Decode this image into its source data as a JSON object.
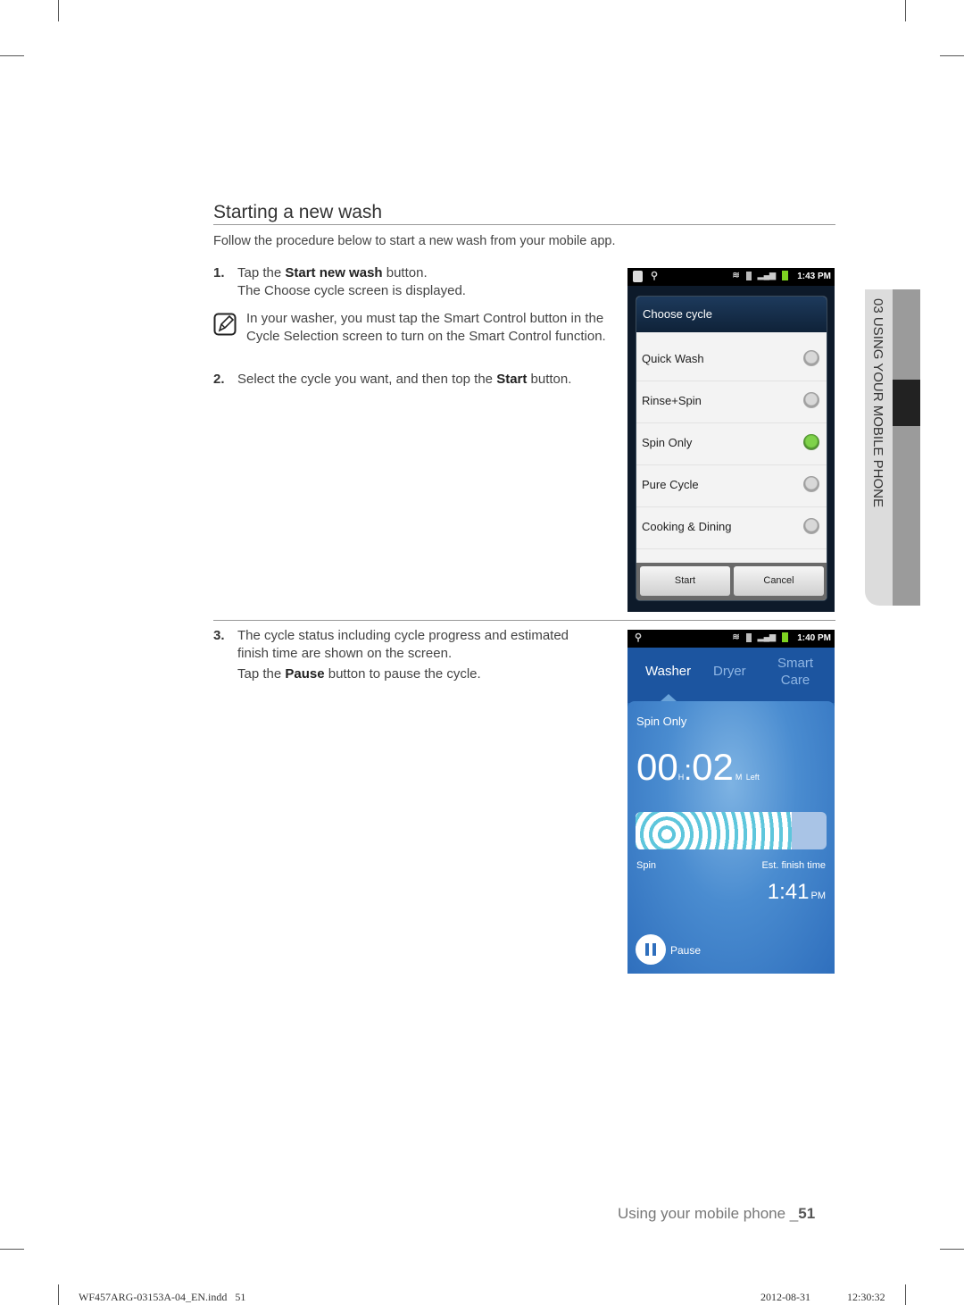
{
  "section": {
    "title": "Starting a new wash",
    "intro": "Follow the procedure below to start a new wash from your mobile app."
  },
  "steps": [
    {
      "number": "1.",
      "pre": "Tap the ",
      "bold": "Start new wash",
      "post": " button.",
      "sub": "The Choose cycle screen is displayed."
    },
    {
      "number": "2.",
      "pre": "Select the cycle you want, and then top the ",
      "bold": "Start",
      "post": " button."
    },
    {
      "number": "3.",
      "line1": "The cycle status including cycle progress and estimated",
      "line2": "finish time are shown on the screen.",
      "pre": "Tap the ",
      "bold": "Pause",
      "post": " button to pause the cycle."
    }
  ],
  "note": {
    "icon": "note-pencil-icon",
    "text": "In your washer, you must tap the Smart Control button in the Cycle Selection screen to turn on the Smart Control function."
  },
  "phone1": {
    "status_time": "1:43 PM",
    "dialog_title": "Choose cycle",
    "cycles": [
      {
        "label": "Quick Wash",
        "selected": false
      },
      {
        "label": "Rinse+Spin",
        "selected": false
      },
      {
        "label": "Spin Only",
        "selected": true
      },
      {
        "label": "Pure Cycle",
        "selected": false
      },
      {
        "label": "Cooking & Dining",
        "selected": false
      }
    ],
    "start_label": "Start",
    "cancel_label": "Cancel"
  },
  "phone2": {
    "status_time": "1:40 PM",
    "tabs": [
      "Washer",
      "Dryer",
      "Smart Care"
    ],
    "active_tab": "Washer",
    "cycle_name": "Spin Only",
    "hours": "00",
    "hours_unit": "H",
    "minutes": "02",
    "minutes_unit": "M",
    "left_label": "Left",
    "progress_fraction": 0.82,
    "phase_label": "Spin",
    "est_label": "Est. finish time",
    "finish_time": "1:41",
    "finish_ampm": "PM",
    "pause_label": "Pause",
    "colors": {
      "tab_active": "#ffffff",
      "tab_inactive": "#8fb6e4",
      "progress": "#5ec6dc"
    }
  },
  "side_tab": {
    "text": "03 USING YOUR MOBILE PHONE"
  },
  "footer": {
    "page_label": "Using your mobile phone _",
    "page_number": "51",
    "file": "WF457ARG-03153A-04_EN.indd   51",
    "date": "2012-08-31",
    "time": "12:30:32"
  }
}
